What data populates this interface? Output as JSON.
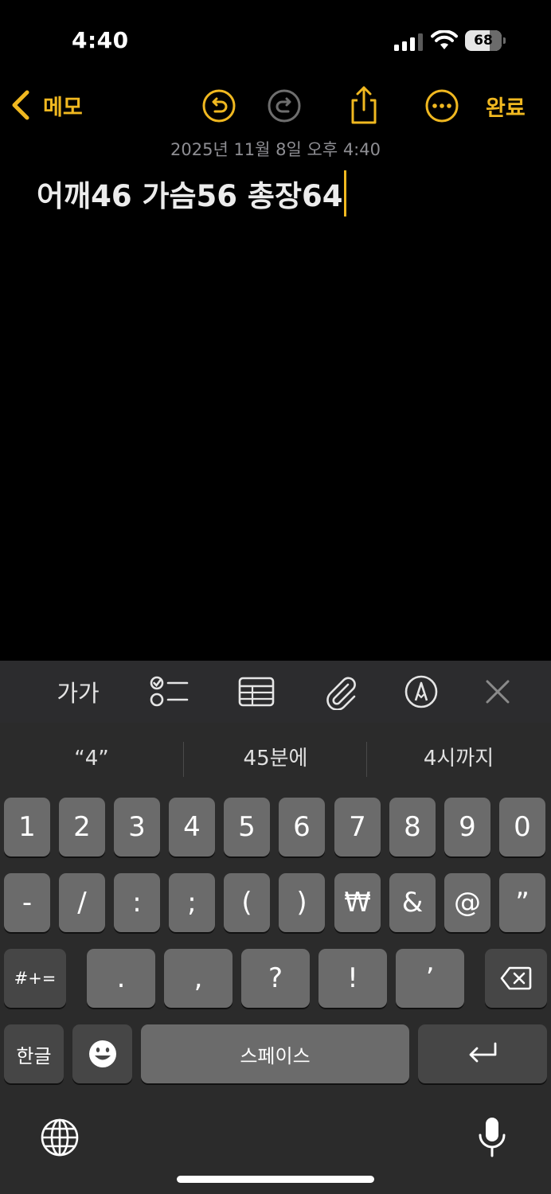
{
  "status_bar": {
    "time": "4:40",
    "battery_level": "68",
    "battery_fraction": 0.68
  },
  "toolbar": {
    "back_label": "메모",
    "done_label": "완료",
    "icons": [
      "undo-icon",
      "redo-icon",
      "share-icon",
      "more-icon"
    ],
    "accent_color": "#f0b820"
  },
  "note": {
    "date": "2025년 11월 8일 오후 4:40",
    "body": "어깨46 가슴56 총장64"
  },
  "format_bar": {
    "text_format_label": "가가",
    "icons": [
      "checklist-icon",
      "table-icon",
      "attachment-icon",
      "markup-icon",
      "close-icon"
    ]
  },
  "keyboard": {
    "suggestions": [
      "“4”",
      "45분에",
      "4시까지"
    ],
    "row1": [
      "1",
      "2",
      "3",
      "4",
      "5",
      "6",
      "7",
      "8",
      "9",
      "0"
    ],
    "row2": [
      "-",
      "/",
      ":",
      ";",
      "(",
      ")",
      "₩",
      "&",
      "@",
      "”"
    ],
    "row3": {
      "symbols_key": "#+=",
      "keys": [
        ".",
        ",",
        "?",
        "!",
        "’"
      ],
      "delete_icon": "backspace-icon"
    },
    "row4": {
      "lang_key": "한글",
      "emoji_icon": "emoji-icon",
      "space_key": "스페이스",
      "return_icon": "return-icon"
    },
    "bottom": {
      "globe_icon": "globe-icon",
      "mic_icon": "microphone-icon"
    }
  }
}
